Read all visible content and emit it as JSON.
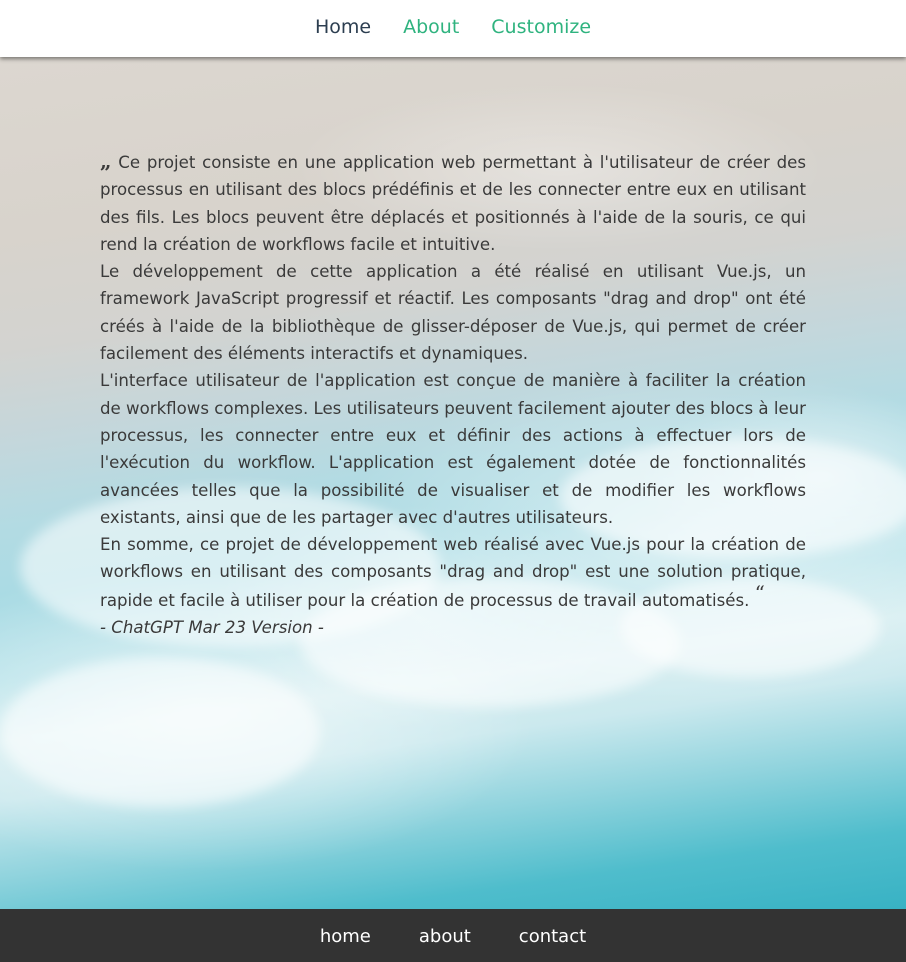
{
  "topnav": {
    "home": "Home",
    "about": "About",
    "customize": "Customize"
  },
  "quote": {
    "open_mark": "„",
    "paragraphs": [
      "Ce projet consiste en une application web permettant à l'utilisateur de créer des processus en utilisant des blocs prédéfinis et de les connecter entre eux en utilisant des fils. Les blocs peuvent être déplacés et positionnés à l'aide de la souris, ce qui rend la création de workflows facile et intuitive.",
      "Le développement de cette application a été réalisé en utilisant Vue.js, un framework JavaScript progressif et réactif. Les composants \"drag and drop\" ont été créés à l'aide de la bibliothèque de glisser-déposer de Vue.js, qui permet de créer facilement des éléments interactifs et dynamiques.",
      "L'interface utilisateur de l'application est conçue de manière à faciliter la création de workflows complexes. Les utilisateurs peuvent facilement ajouter des blocs à leur processus, les connecter entre eux et définir des actions à effectuer lors de l'exécution du workflow. L'application est également dotée de fonctionnalités avancées telles que la possibilité de visualiser et de modifier les workflows existants, ainsi que de les partager avec d'autres utilisateurs.",
      "En somme, ce projet de développement web réalisé avec Vue.js pour la création de workflows en utilisant des composants \"drag and drop\" est une solution pratique, rapide et facile à utiliser pour la création de processus de travail automatisés."
    ],
    "close_mark": "“",
    "author": "- ChatGPT Mar 23 Version -"
  },
  "footer": {
    "home": "home",
    "about": "about",
    "contact": "contact"
  },
  "colors": {
    "nav_active": "#2c3e50",
    "nav_link": "#2fb37f",
    "footer_bg": "#333333",
    "text": "#3a3a3a"
  }
}
